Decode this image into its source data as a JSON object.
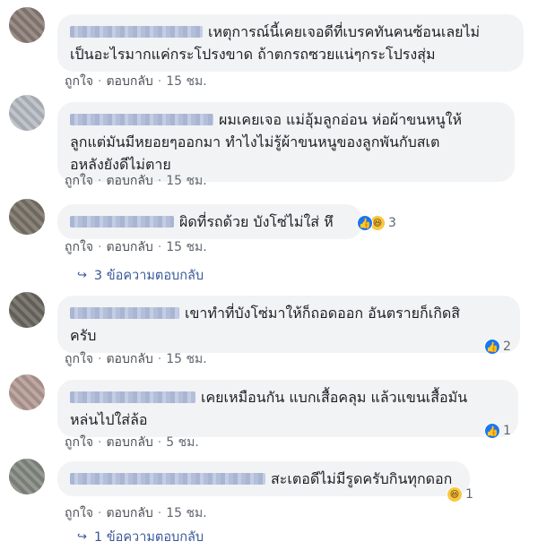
{
  "comments": [
    {
      "lines": [
        "เหตุการณ์นี้เคยเจอดีที่เบรคทันคนซ้อนเลยไม่",
        "เป็นอะไรมากแค่กระโปรงขาด ถ้าตกรถซวยแน่ๆกระโปรงสุ่ม"
      ],
      "like_label": "ถูกใจ",
      "reply_label": "ตอบกลับ",
      "time": "15 ชม."
    },
    {
      "lines": [
        "ผมเคยเจอ แม่อุ้มลูกอ่อน ห่อผ้าขนหนูให้",
        "ลูกแต่มันมีหยอยๆออกมา ทำไงไม่รู้ผ้าขนหนูของลูกพันกับสเต",
        "อหลังยังดีไม่ตาย"
      ],
      "like_label": "ถูกใจ",
      "reply_label": "ตอบกลับ",
      "time": "15 ชม."
    },
    {
      "lines": [
        "ผิดที่รถด้วย บังโซ่ไม่ใส่ หึ"
      ],
      "like_label": "ถูกใจ",
      "reply_label": "ตอบกลับ",
      "time": "15 ชม.",
      "reactions": [
        "like-icon",
        "haha-icon"
      ],
      "reaction_count": "3",
      "replies_text": "3 ข้อความตอบกลับ"
    },
    {
      "lines": [
        "เขาทำที่บังโซ่มาให้ก็ถอดออก อันตรายก็เกิดสิ",
        "ครับ"
      ],
      "like_label": "ถูกใจ",
      "reply_label": "ตอบกลับ",
      "time": "15 ชม.",
      "reactions": [
        "like-icon"
      ],
      "reaction_count": "2"
    },
    {
      "lines": [
        "เคยเหมือนกัน แบกเสื้อคลุม แล้วแขนเสื้อมัน",
        "หล่นไปใส่ล้อ"
      ],
      "like_label": "ถูกใจ",
      "reply_label": "ตอบกลับ",
      "time": "5 ชม.",
      "reactions": [
        "like-icon"
      ],
      "reaction_count": "1"
    },
    {
      "lines": [
        "สะเตอดีไม่มีรูดครับกินทุกดอก"
      ],
      "like_label": "ถูกใจ",
      "reply_label": "ตอบกลับ",
      "time": "15 ชม.",
      "reactions": [
        "haha-icon"
      ],
      "reaction_count": "1",
      "replies_text": "1 ข้อความตอบกลับ"
    }
  ],
  "colors": {
    "link": "#385898",
    "bubble": "#f2f3f5",
    "like": "#1877f2",
    "haha": "#f7c842"
  }
}
